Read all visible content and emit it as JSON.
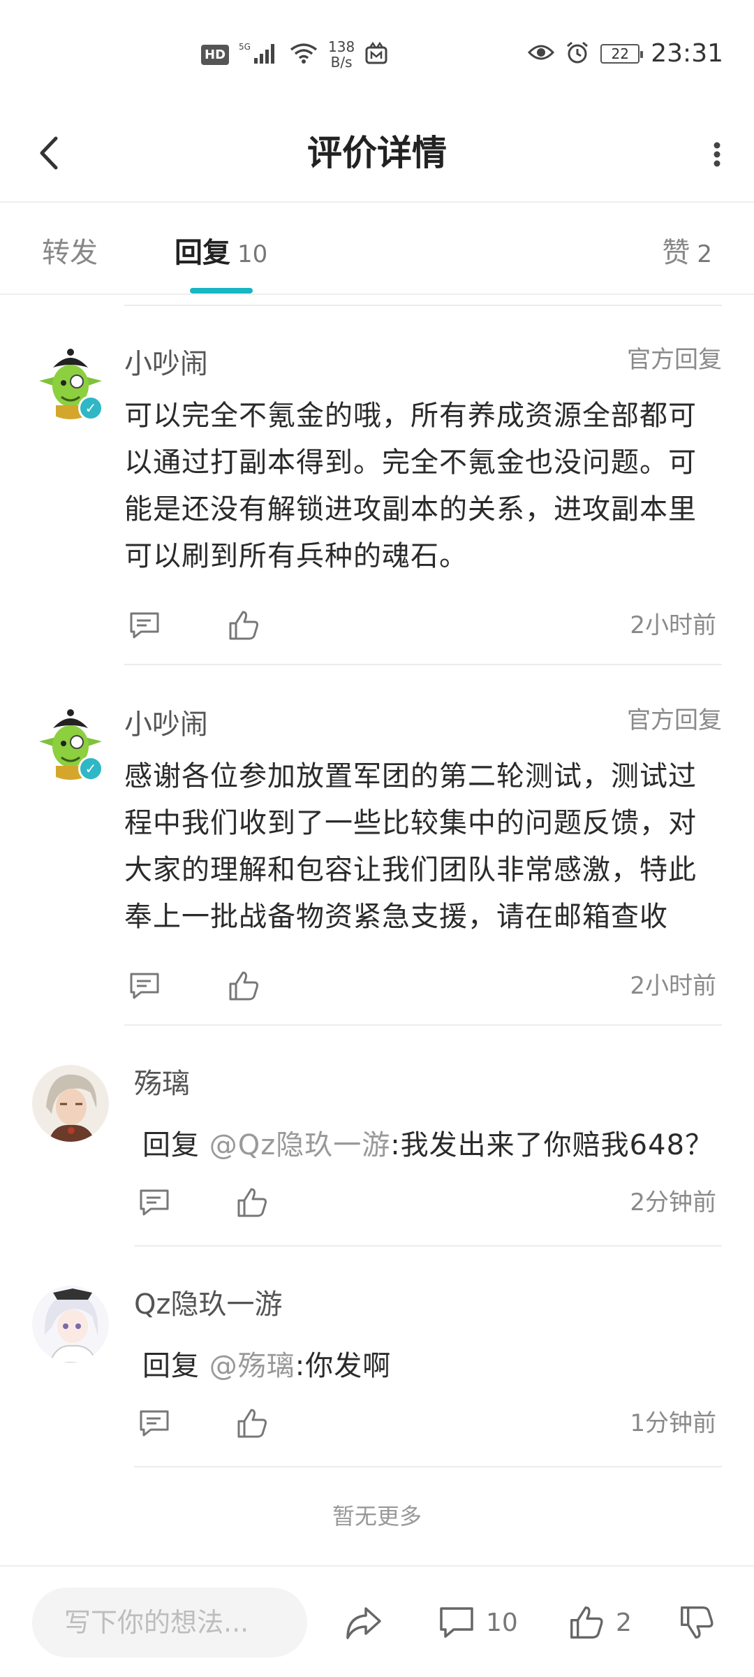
{
  "status_bar": {
    "hd": "HD",
    "network": "5G",
    "speed_value": "138",
    "speed_unit": "B/s",
    "battery": "22",
    "time": "23:31"
  },
  "header": {
    "title": "评价详情"
  },
  "tabs": [
    {
      "label": "转发",
      "count": ""
    },
    {
      "label": "回复",
      "count": "10"
    },
    {
      "label": "赞",
      "count": "2"
    }
  ],
  "replies": [
    {
      "username": "小吵闹",
      "badge": "官方回复",
      "content_lines": [
        "可以完全不氪金的哦，所有养成资源全部都可",
        "以通过打副本得到。完全不氪金也没问题。可",
        "能是还没有解锁进攻副本的关系，进攻副本里",
        "可以刷到所有兵种的魂石。"
      ],
      "time": "2小时前"
    },
    {
      "username": "小吵闹",
      "badge": "官方回复",
      "content_lines": [
        "感谢各位参加放置军团的第二轮测试，测试过",
        "程中我们收到了一些比较集中的问题反馈，对",
        "大家的理解和包容让我们团队非常感激，特此",
        "奉上一批战备物资紧急支援，请在邮箱查收"
      ],
      "time": "2小时前"
    },
    {
      "username": "殇璃",
      "reply_prefix": "回复 ",
      "mention": "@Qz隐玖一游",
      "text": ":我发出来了你赔我648？",
      "time": "2分钟前"
    },
    {
      "username": "Qz隐玖一游",
      "reply_prefix": "回复 ",
      "mention": "@殇璃",
      "text": ":你发啊",
      "time": "1分钟前"
    }
  ],
  "no_more": "暂无更多",
  "bottom_bar": {
    "input_placeholder": "写下你的想法...",
    "comment_count": "10",
    "like_count": "2"
  },
  "colors": {
    "accent": "#17b6c2",
    "mention": "#999999"
  }
}
